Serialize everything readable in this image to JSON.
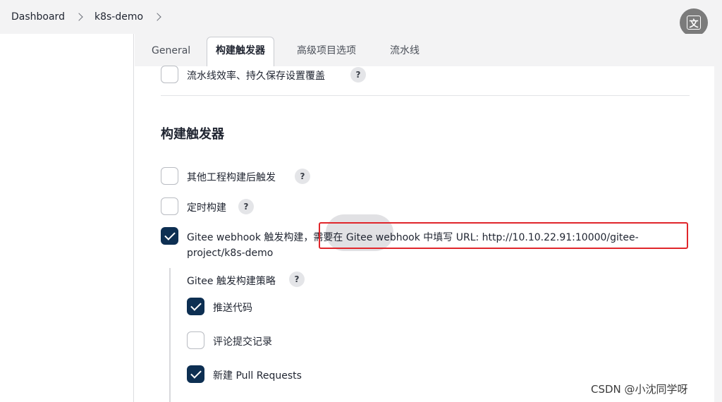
{
  "breadcrumb": {
    "items": [
      "Dashboard",
      "k8s-demo"
    ]
  },
  "tabs": [
    {
      "label": "General",
      "active": false
    },
    {
      "label": "构建触发器",
      "active": true
    },
    {
      "label": "高级项目选项",
      "active": false
    },
    {
      "label": "流水线",
      "active": false
    }
  ],
  "translate_button": {
    "icon": "translate-icon",
    "glyph": "文"
  },
  "options": {
    "pipeline_speed": {
      "label": "流水线效率、持久保存设置覆盖",
      "checked": false
    }
  },
  "section": {
    "title": "构建触发器",
    "triggers": [
      {
        "label": "其他工程构建后触发",
        "checked": false
      },
      {
        "label": "定时构建",
        "checked": false
      }
    ],
    "gitee": {
      "label_line1": "Gitee webhook 触发构建，需要在 Gitee webhook 中填写 URL: http://10.10.22.91:10000/gitee-",
      "label_line2": "project/k8s-demo",
      "checked": true
    },
    "strategy": {
      "title": "Gitee 触发构建策略",
      "items": [
        {
          "label": "推送代码",
          "checked": true
        },
        {
          "label": "评论提交记录",
          "checked": false
        },
        {
          "label": "新建 Pull Requests",
          "checked": true
        }
      ]
    }
  },
  "help_glyph": "?",
  "watermark": "CSDN @小沈同学呀",
  "colors": {
    "checked": "#0d2f52",
    "annotation_box": "#e0262b"
  }
}
